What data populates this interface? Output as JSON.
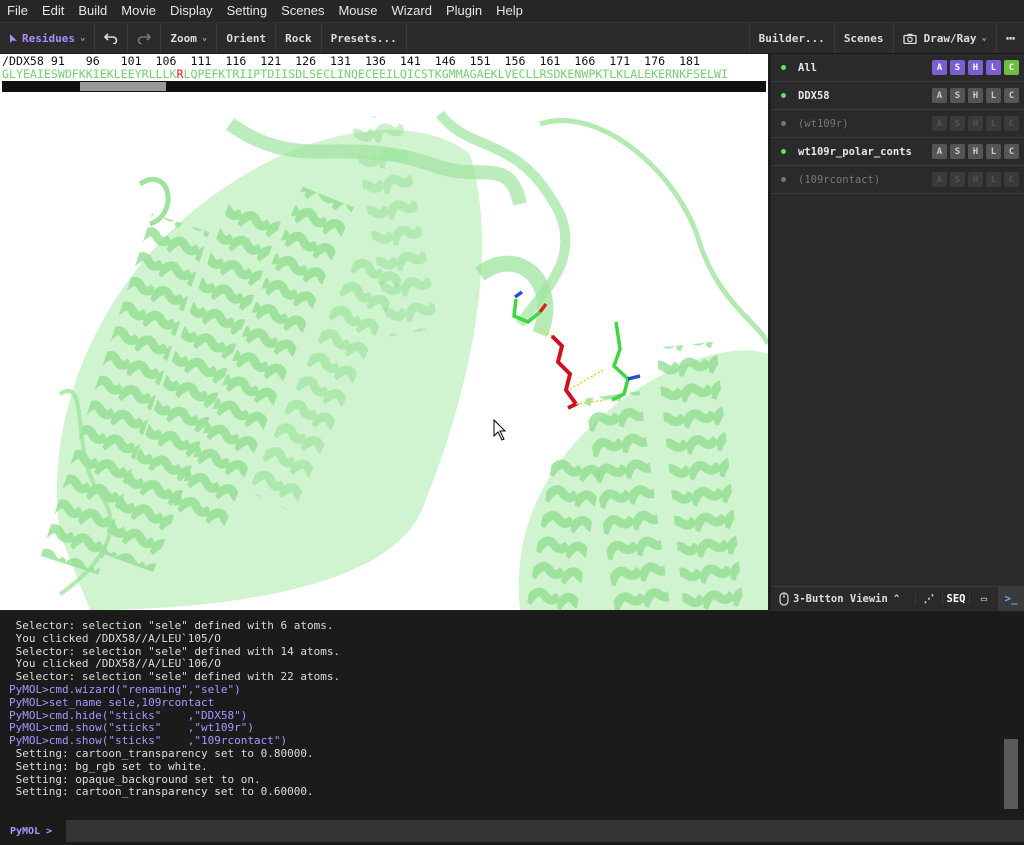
{
  "menu": [
    "File",
    "Edit",
    "Build",
    "Movie",
    "Display",
    "Setting",
    "Scenes",
    "Mouse",
    "Wizard",
    "Plugin",
    "Help"
  ],
  "toolbar": {
    "mode": "Residues",
    "zoom": "Zoom",
    "orient": "Orient",
    "rock": "Rock",
    "presets": "Presets...",
    "builder": "Builder...",
    "scenes": "Scenes",
    "drawray": "Draw/Ray",
    "more": "⋯"
  },
  "sequence": {
    "numbers": "/DDX58 91   96   101  106  111  116  121  126  131  136  141  146  151  156  161  166  171  176  181",
    "residues_before": "GLYEAIESWDFKKIEKLEEYRLLLK",
    "residue_highlight": "R",
    "residues_after": "LQPEFKTRIIPTDIISDLSECLINQECEEILQICSTKGMMAGAEKLVECLLRSDKENWPKTLKLALEKERNKFSELWI"
  },
  "objects": [
    {
      "name": "All",
      "enabled": true,
      "style": "all"
    },
    {
      "name": "DDX58",
      "enabled": true,
      "style": "normal"
    },
    {
      "name": "(wt109r)",
      "enabled": false,
      "style": "off"
    },
    {
      "name": "wt109r_polar_conts",
      "enabled": true,
      "style": "normal"
    },
    {
      "name": "(109rcontact)",
      "enabled": false,
      "style": "off"
    }
  ],
  "object_buttons": [
    "A",
    "S",
    "H",
    "L",
    "C"
  ],
  "viewbar": {
    "mouse_mode": "3-Button Viewin",
    "seq": "SEQ"
  },
  "console_lines": [
    {
      "text": " Selector: selection \"sele\" defined with 6 atoms.",
      "cmd": false
    },
    {
      "text": " You clicked /DDX58//A/LEU`105/O",
      "cmd": false
    },
    {
      "text": " Selector: selection \"sele\" defined with 14 atoms.",
      "cmd": false
    },
    {
      "text": " You clicked /DDX58//A/LEU`106/O",
      "cmd": false
    },
    {
      "text": " Selector: selection \"sele\" defined with 22 atoms.",
      "cmd": false
    },
    {
      "text": "PyMOL>cmd.wizard(\"renaming\",\"sele\")",
      "cmd": true
    },
    {
      "text": "PyMOL>set_name sele,109rcontact",
      "cmd": true
    },
    {
      "text": "PyMOL>cmd.hide(\"sticks\"    ,\"DDX58\")",
      "cmd": true
    },
    {
      "text": "PyMOL>cmd.show(\"sticks\"    ,\"wt109r\")",
      "cmd": true
    },
    {
      "text": "PyMOL>cmd.show(\"sticks\"    ,\"109rcontact\")",
      "cmd": true
    },
    {
      "text": " Setting: cartoon_transparency set to 0.80000.",
      "cmd": false
    },
    {
      "text": " Setting: bg_rgb set to white.",
      "cmd": false
    },
    {
      "text": " Setting: opaque_background set to on.",
      "cmd": false
    },
    {
      "text": " Setting: cartoon_transparency set to 0.60000.",
      "cmd": false
    }
  ],
  "prompt": "PyMOL >",
  "colors": {
    "accent": "#a98cff",
    "protein": "#8ee08e",
    "residue_red": "#d01020",
    "carbon_green": "#3ed83e"
  }
}
